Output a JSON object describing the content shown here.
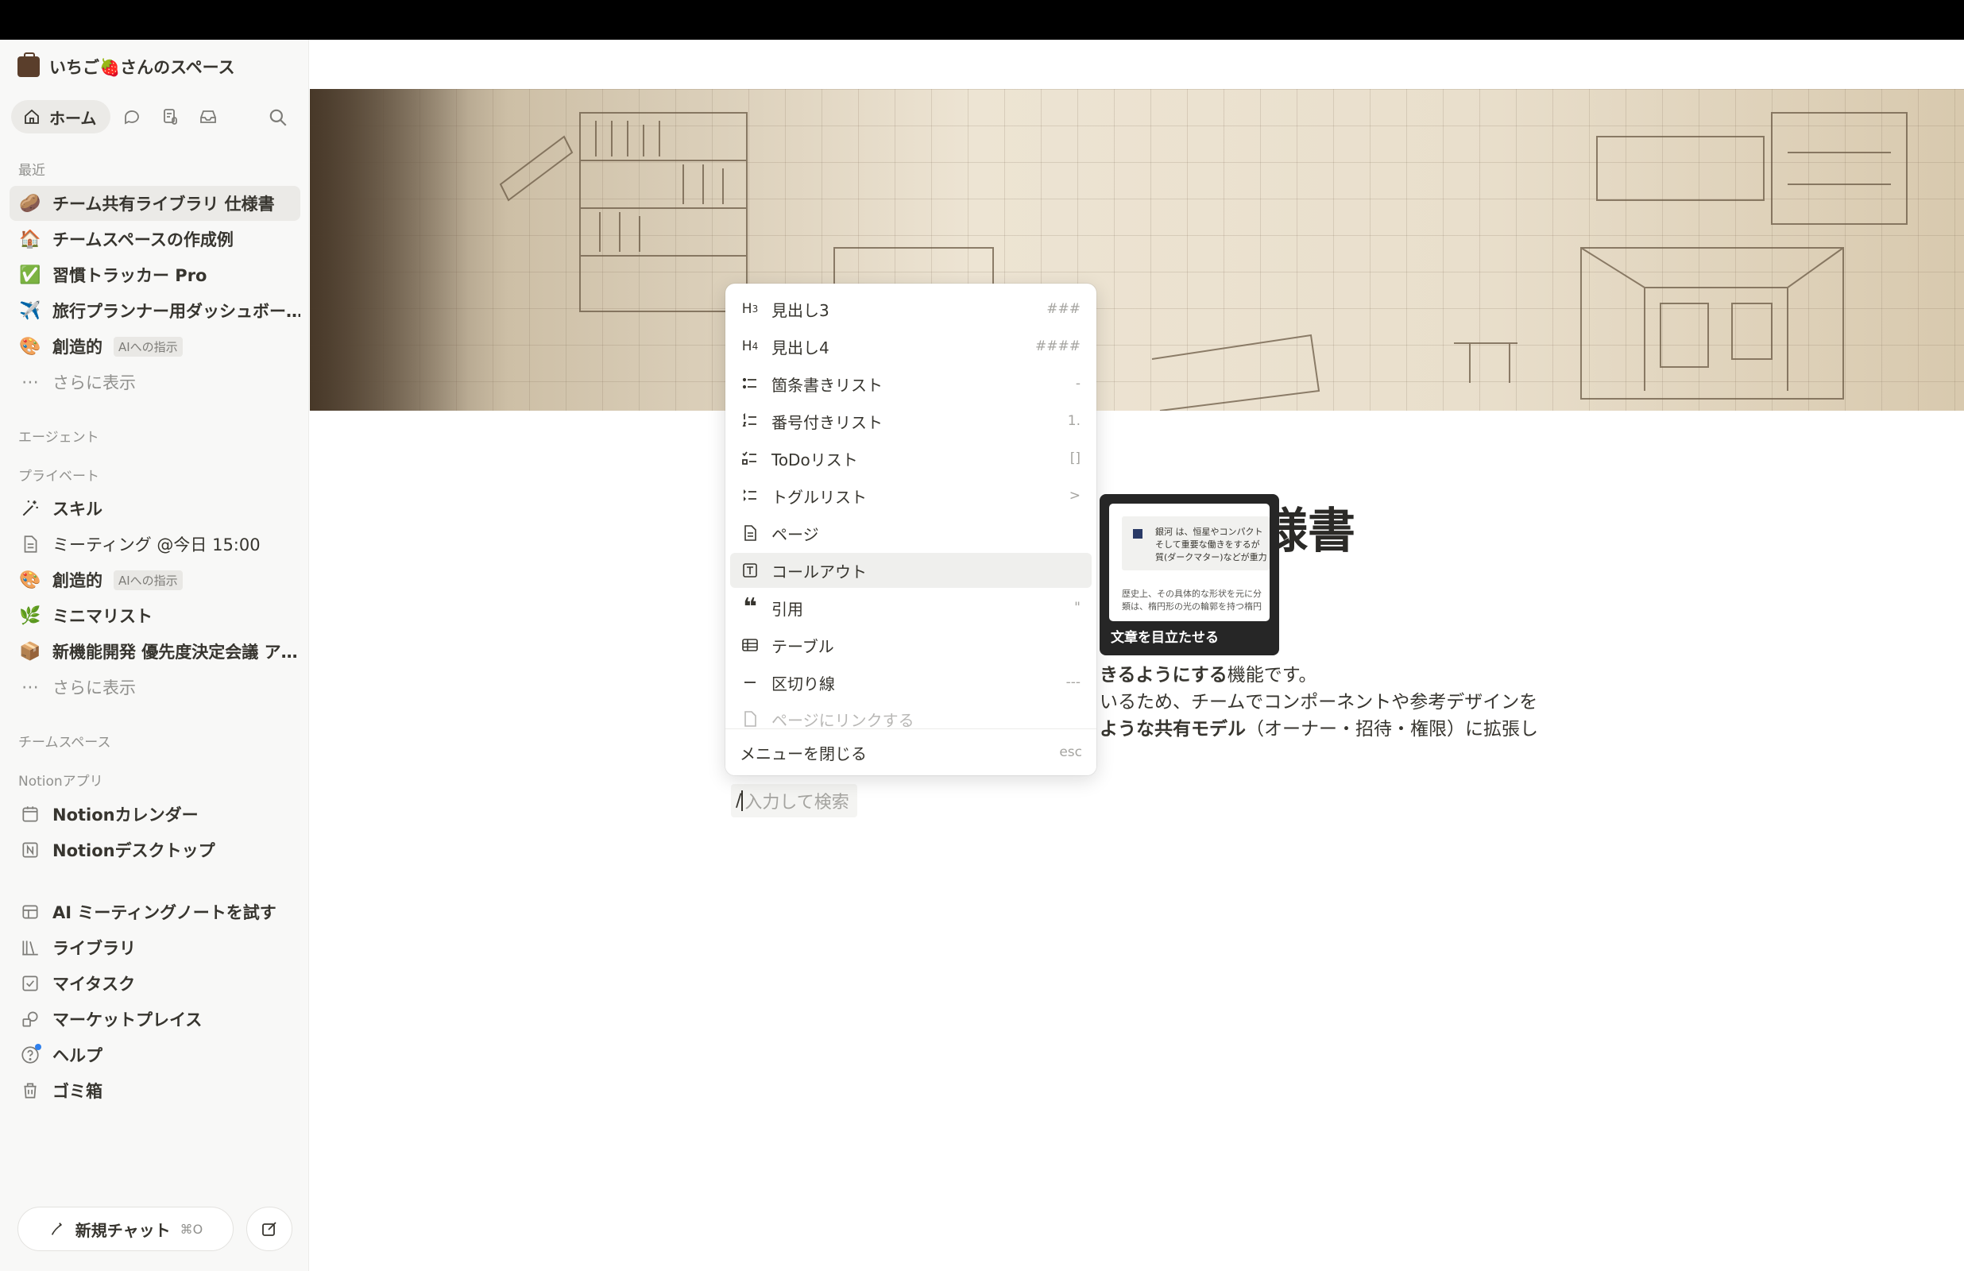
{
  "workspace": {
    "name": "いちご🍓さんのスペース"
  },
  "nav": {
    "home_label": "ホーム"
  },
  "sidebar": {
    "recent_label": "最近",
    "recent": [
      {
        "label": "チーム共有ライブラリ 仕様書",
        "icon": "🥔"
      },
      {
        "label": "チームスペースの作成例",
        "icon": "🏠"
      },
      {
        "label": "習慣トラッカー Pro",
        "icon": "✅"
      },
      {
        "label": "旅行プランナー用ダッシュボー…",
        "icon": "✈️"
      },
      {
        "label": "創造的",
        "icon": "🎨",
        "badge": "AIへの指示"
      }
    ],
    "more_label": "さらに表示",
    "agent_label": "エージェント",
    "private_label": "プライベート",
    "private": [
      {
        "label": "スキル",
        "icon": "✨"
      },
      {
        "label": "ミーティング @今日 15:00",
        "icon": "📄"
      },
      {
        "label": "創造的",
        "icon": "🎨",
        "badge": "AIへの指示"
      },
      {
        "label": "ミニマリスト",
        "icon": "🌿"
      },
      {
        "label": "新機能開発 優先度決定会議 ア…",
        "icon": "📦"
      }
    ],
    "more_label2": "さらに表示",
    "teamspace_label": "チームスペース",
    "apps_label": "Notionアプリ",
    "apps": [
      {
        "label": "Notionカレンダー"
      },
      {
        "label": "Notionデスクトップ"
      }
    ],
    "bottom": [
      {
        "label": "AI ミーティングノートを試す"
      },
      {
        "label": "ライブラリ"
      },
      {
        "label": "マイタスク"
      },
      {
        "label": "マーケットプレイス"
      },
      {
        "label": "ヘルプ"
      },
      {
        "label": "ゴミ箱"
      }
    ],
    "new_chat": {
      "label": "新規チャット",
      "shortcut": "⌘O"
    }
  },
  "page": {
    "title_fragment": "様書",
    "lines": [
      {
        "bold": "きるようにする",
        "rest": "機能です。"
      },
      {
        "bold": "",
        "rest": "いるため、チームでコンポーネントや参考デザインを"
      },
      {
        "bold": "ような共有モデル",
        "rest": "（オーナー・招待・権限）に拡張し"
      }
    ],
    "slash_placeholder": "入力して検索",
    "slash_char": "/"
  },
  "menu": {
    "items": [
      {
        "label": "見出し3",
        "shortcut": "###",
        "icon": "h3-icon"
      },
      {
        "label": "見出し4",
        "shortcut": "####",
        "icon": "h4-icon"
      },
      {
        "label": "箇条書きリスト",
        "shortcut": "-",
        "icon": "bullet-list-icon"
      },
      {
        "label": "番号付きリスト",
        "shortcut": "1.",
        "icon": "numbered-list-icon"
      },
      {
        "label": "ToDoリスト",
        "shortcut": "[]",
        "icon": "todo-list-icon"
      },
      {
        "label": "トグルリスト",
        "shortcut": ">",
        "icon": "toggle-list-icon"
      },
      {
        "label": "ページ",
        "shortcut": "",
        "icon": "page-icon"
      },
      {
        "label": "コールアウト",
        "shortcut": "",
        "icon": "callout-icon",
        "selected": true
      },
      {
        "label": "引用",
        "shortcut": "\"",
        "icon": "quote-icon"
      },
      {
        "label": "テーブル",
        "shortcut": "",
        "icon": "table-icon"
      },
      {
        "label": "区切り線",
        "shortcut": "---",
        "icon": "divider-icon"
      },
      {
        "label": "ページにリンクする",
        "shortcut": "",
        "icon": "link-page-icon"
      }
    ],
    "close_label": "メニューを閉じる",
    "close_shortcut": "esc"
  },
  "preview": {
    "caption": "文章を目立たせる",
    "callout_text": [
      "銀河 は、恒星やコンパクト",
      "そして重要な働きをするが",
      "質(ダークマター)などが重力"
    ],
    "body_text": [
      "歴史上、その具体的な形状を元に分",
      "類は、楕円形の光の輪郭を持つ楕円"
    ]
  }
}
